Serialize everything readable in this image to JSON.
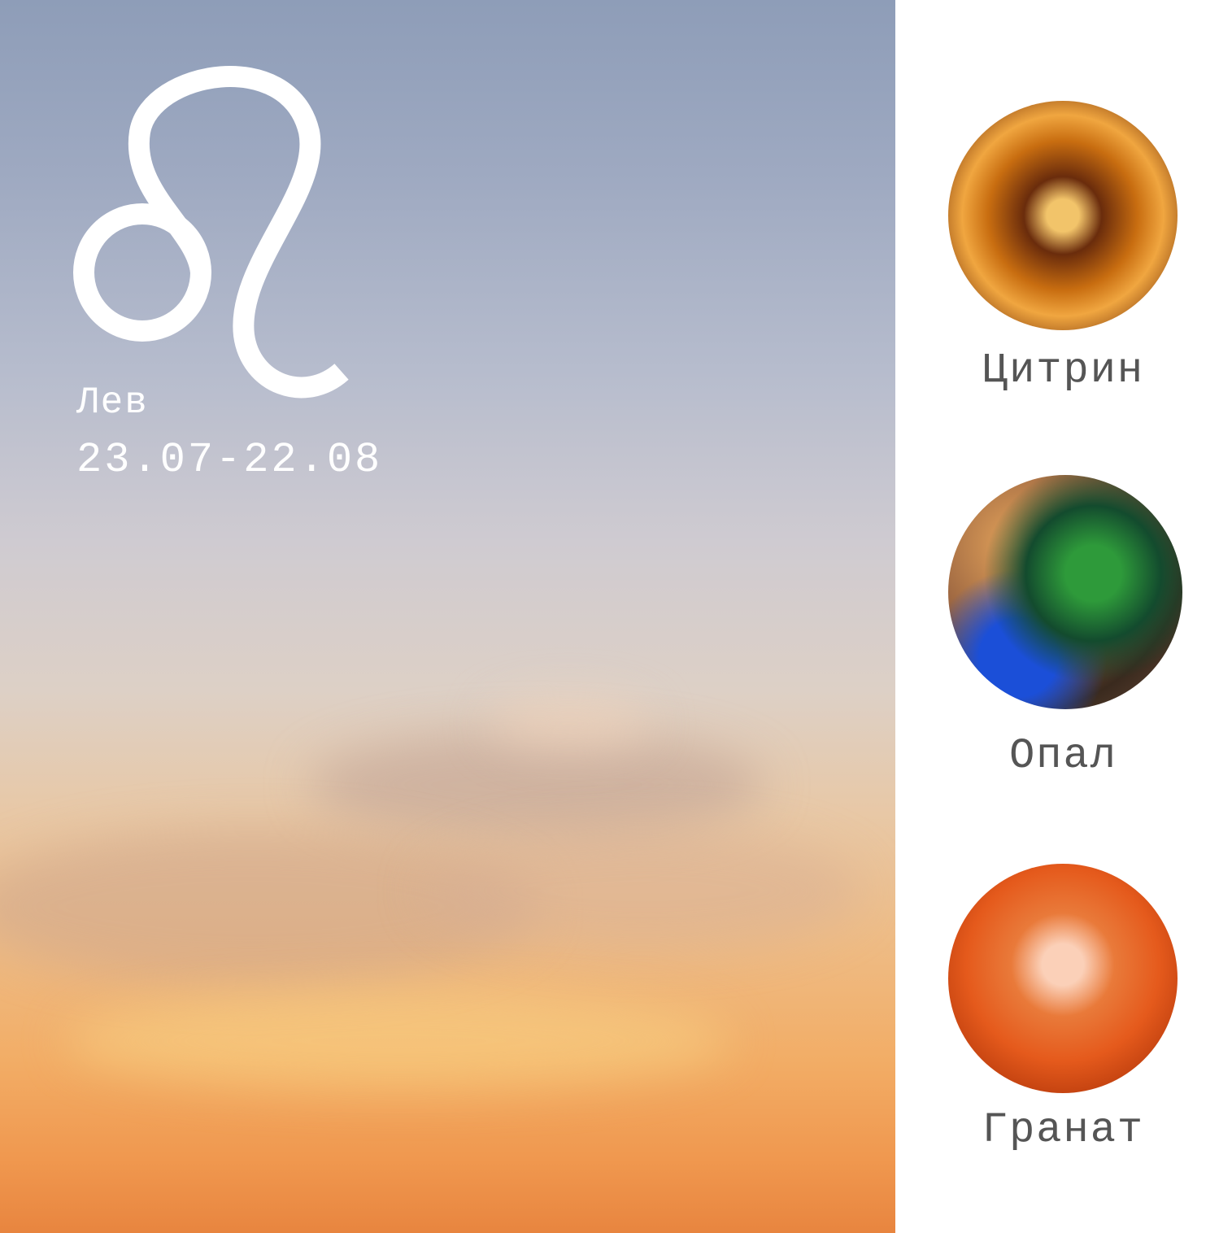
{
  "sign": {
    "symbol_icon": "leo-zodiac-icon",
    "name": "Лев",
    "dates": "23.07-22.08"
  },
  "stones": [
    {
      "label": "Цитрин",
      "image": "citrine-gem-image",
      "colors": [
        "#f5c46a",
        "#c86d10",
        "#5a2608"
      ]
    },
    {
      "label": "Опал",
      "image": "opal-gem-image",
      "colors": [
        "#e7a65c",
        "#2f9a3c",
        "#1b4fd8"
      ]
    },
    {
      "label": "Гранат",
      "image": "garnet-gem-image",
      "colors": [
        "#fbd0b8",
        "#e55a1c",
        "#a8300a"
      ]
    }
  ]
}
